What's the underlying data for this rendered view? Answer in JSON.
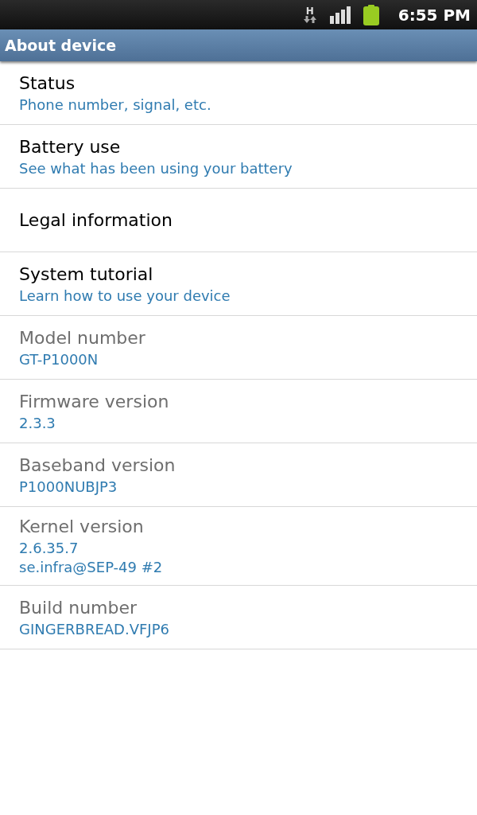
{
  "status_bar": {
    "network": "H",
    "time": "6:55 PM"
  },
  "title": "About device",
  "items": [
    {
      "title": "Status",
      "summary": "Phone number, signal, etc.",
      "disabled": false
    },
    {
      "title": "Battery use",
      "summary": "See what has been using your battery",
      "disabled": false
    },
    {
      "title": "Legal information",
      "disabled": false
    },
    {
      "title": "System tutorial",
      "summary": "Learn how to use your device",
      "disabled": false
    },
    {
      "title": "Model number",
      "summary": "GT-P1000N",
      "disabled": true
    },
    {
      "title": "Firmware version",
      "summary": "2.3.3",
      "disabled": true
    },
    {
      "title": "Baseband version",
      "summary": "P1000NUBJP3",
      "disabled": true
    },
    {
      "title": "Kernel version",
      "summary": "2.6.35.7\nse.infra@SEP-49 #2",
      "disabled": true
    },
    {
      "title": "Build number",
      "summary": "GINGERBREAD.VFJP6",
      "disabled": true
    }
  ]
}
